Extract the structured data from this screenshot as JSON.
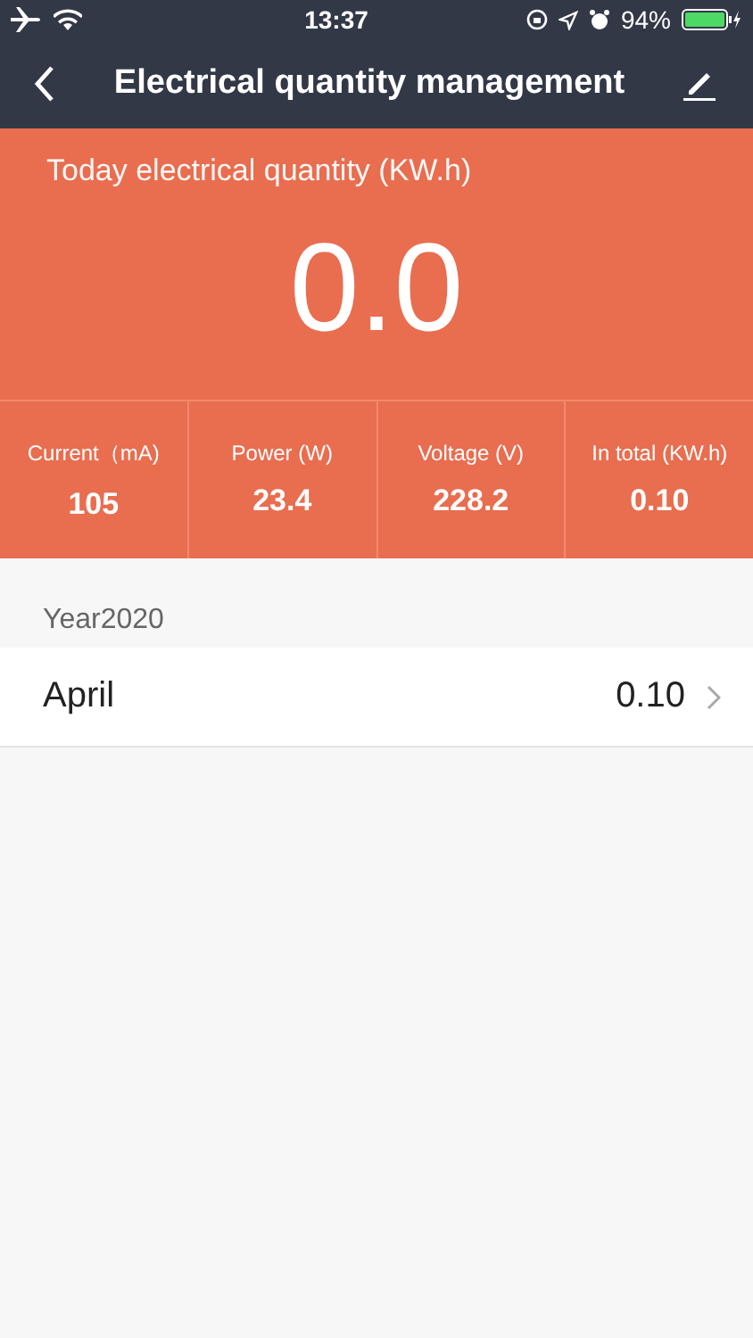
{
  "status_bar": {
    "time": "13:37",
    "battery": "94%"
  },
  "nav": {
    "title": "Electrical quantity management"
  },
  "today": {
    "label": "Today electrical quantity (KW.h)",
    "value": "0.0"
  },
  "stats": [
    {
      "label": "Current（mA)",
      "value": "105"
    },
    {
      "label": "Power (W)",
      "value": "23.4"
    },
    {
      "label": "Voltage (V)",
      "value": "228.2"
    },
    {
      "label": "In total (KW.h)",
      "value": "0.10"
    }
  ],
  "sections": [
    {
      "title": "Year2020",
      "rows": [
        {
          "month": "April",
          "value": "0.10"
        }
      ]
    }
  ]
}
